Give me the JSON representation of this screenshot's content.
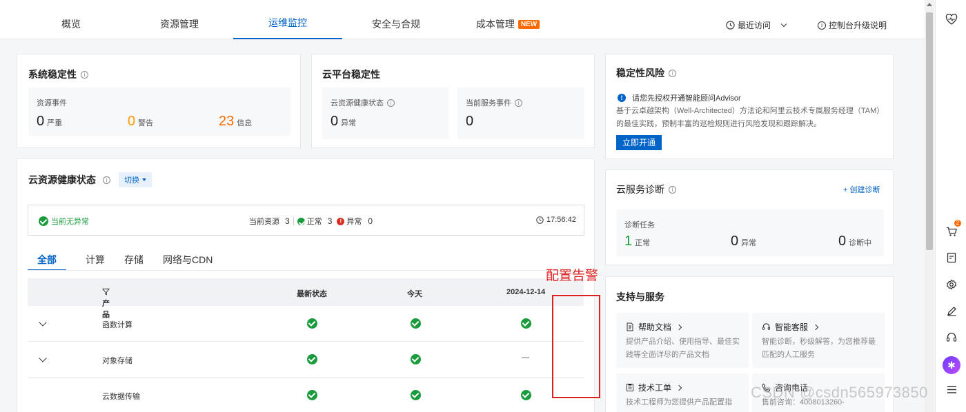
{
  "nav": {
    "tabs": [
      {
        "label": "概览"
      },
      {
        "label": "资源管理"
      },
      {
        "label": "运维监控"
      },
      {
        "label": "安全与合规"
      },
      {
        "label": "成本管理",
        "badge": "NEW"
      }
    ],
    "recent_label": "最近访问",
    "upgrade_label": "控制台升级说明"
  },
  "system_stability": {
    "title": "系统稳定性",
    "box_label": "资源事件",
    "severe": {
      "value": "0",
      "label": "严重"
    },
    "warning": {
      "value": "0",
      "label": "警告"
    },
    "info": {
      "value": "23",
      "label": "信息"
    }
  },
  "cloud_stability": {
    "title": "云平台稳定性",
    "health": {
      "label": "云资源健康状态",
      "value": "0",
      "unit": "异常"
    },
    "events": {
      "label": "当前服务事件",
      "value": "0"
    }
  },
  "stability_risk": {
    "title": "稳定性风险",
    "notice": "请您先授权开通智能顾问Advisor",
    "desc": "基于云卓越架构（Well-Architected）方法论和阿里云技术专属服务经理（TAM）的最佳实践，预制丰富的巡检规则进行风险发现和跟踪解决。",
    "button": "立即开通"
  },
  "health_status": {
    "title": "云资源健康状态",
    "switch_label": "切换",
    "status_text": "当前无异常",
    "resources_label": "当前资源",
    "resources_value": "3",
    "normal_label": "正常",
    "normal_value": "3",
    "abnormal_label": "异常",
    "abnormal_value": "0",
    "time": "17:56:42",
    "subtabs": [
      "全部",
      "计算",
      "存储",
      "网络与CDN"
    ],
    "columns": {
      "product": "产品",
      "latest": "最新状态",
      "today": "今天",
      "date": "2024-12-14"
    },
    "rows": [
      {
        "name": "函数计算",
        "latest": "ok",
        "today": "ok",
        "date": "ok"
      },
      {
        "name": "对象存储",
        "latest": "ok",
        "today": "ok",
        "date": "—"
      },
      {
        "name": "云数据传输",
        "latest": "ok",
        "today": "ok",
        "date": "ok"
      }
    ]
  },
  "diagnosis": {
    "title": "云服务诊断",
    "create_label": "+ 创建诊断",
    "box_label": "诊断任务",
    "normal": {
      "value": "1",
      "label": "正常"
    },
    "abnormal": {
      "value": "0",
      "label": "异常"
    },
    "running": {
      "value": "0",
      "label": "诊断中"
    }
  },
  "support": {
    "title": "支持与服务",
    "items": [
      {
        "title": "帮助文档",
        "desc": "提供产品介绍、使用指导、最佳实践等全面详尽的产品文档",
        "icon": "doc-icon"
      },
      {
        "title": "智能客服",
        "desc": "智能诊断，秒级解答，为您推荐最匹配的人工服务",
        "icon": "headset-icon"
      },
      {
        "title": "技术工单",
        "desc": "技术工程师为您提供产品配置指",
        "icon": "ticket-icon"
      },
      {
        "title": "咨询电话",
        "desc": "售前咨询：4008013260-",
        "icon": "phone-icon"
      }
    ]
  },
  "annotation": {
    "text": "配置告警",
    "color": "#e02020"
  },
  "watermark": "CSDN @csdn565973850",
  "cart_count": "2",
  "colors": {
    "primary": "#0064c8",
    "success": "#1a9c3e",
    "warning": "#ff9900",
    "info": "#ff6a00",
    "error": "#d93026"
  }
}
